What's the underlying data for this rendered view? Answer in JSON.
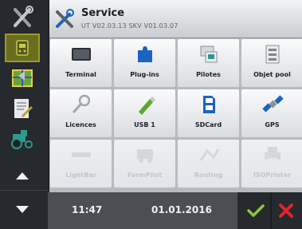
{
  "header": {
    "title": "Service",
    "subtitle": "UT V02.03.13  SKV V01.03.07",
    "icon": "tools-icon"
  },
  "sidebar": {
    "items": [
      {
        "icon": "tools-icon",
        "active": false
      },
      {
        "icon": "controller-icon",
        "active": true
      },
      {
        "icon": "field-map-icon",
        "active": false
      },
      {
        "icon": "document-edit-icon",
        "active": false
      },
      {
        "icon": "tractor-icon",
        "active": false
      }
    ],
    "scroll_up_icon": "arrow-up-icon",
    "scroll_down_icon": "arrow-down-icon"
  },
  "tiles": [
    {
      "label": "Terminal",
      "icon": "terminal-icon",
      "enabled": true
    },
    {
      "label": "Plug-ins",
      "icon": "puzzle-icon",
      "enabled": true
    },
    {
      "label": "Pilotes",
      "icon": "drivers-icon",
      "enabled": true
    },
    {
      "label": "Objet pool",
      "icon": "object-pool-icon",
      "enabled": true
    },
    {
      "label": "Licences",
      "icon": "key-icon",
      "enabled": true
    },
    {
      "label": "USB 1",
      "icon": "usb-stick-icon",
      "enabled": true
    },
    {
      "label": "SDCard",
      "icon": "sd-card-icon",
      "enabled": true
    },
    {
      "label": "GPS",
      "icon": "satellite-icon",
      "enabled": true
    },
    {
      "label": "LightBar",
      "icon": "lightbar-icon",
      "enabled": false
    },
    {
      "label": "FarmPilot",
      "icon": "farmpilot-icon",
      "enabled": false
    },
    {
      "label": "Routing",
      "icon": "routing-icon",
      "enabled": false
    },
    {
      "label": "ISOPrinter",
      "icon": "printer-icon",
      "enabled": false
    }
  ],
  "status": {
    "time": "11:47",
    "date": "01.01.2016"
  },
  "colors": {
    "accent_active": "#9a9b2c",
    "ok_green": "#8cc63e",
    "cancel_red": "#e2232a",
    "usb_green": "#5fa82d",
    "icon_blue": "#1b63c2"
  }
}
